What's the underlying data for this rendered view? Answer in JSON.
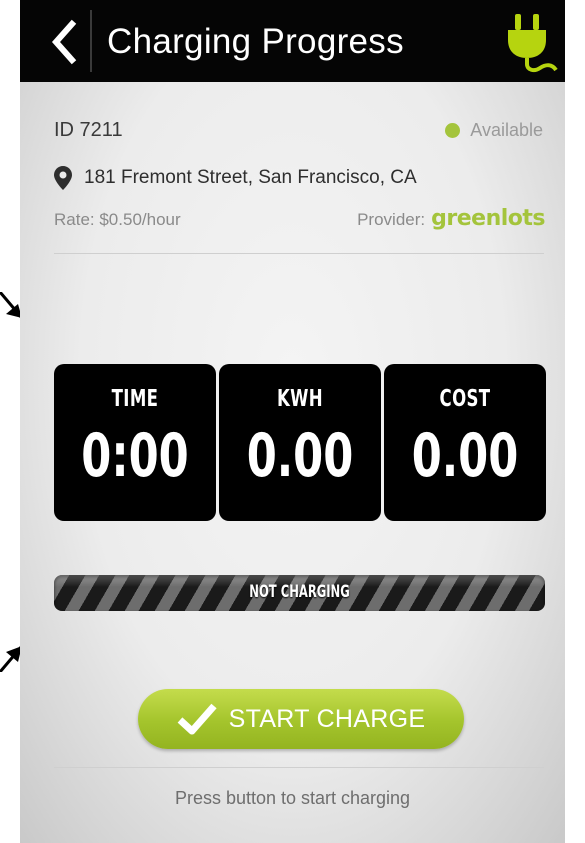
{
  "header": {
    "title": "Charging Progress"
  },
  "station": {
    "id_text": "ID 7211",
    "status_text": "Available",
    "address": "181 Fremont Street, San Francisco, CA",
    "rate": "Rate: $0.50/hour",
    "provider_label": "Provider:",
    "provider_name": "greenlots"
  },
  "meters": {
    "time_label": "TIME",
    "time_value": "0:00",
    "kwh_label": "KWH",
    "kwh_value": "0.00",
    "cost_label": "COST",
    "cost_value": "0.00"
  },
  "progress": {
    "label": "NOT CHARGING",
    "fraction": 0
  },
  "actions": {
    "start_label": "START CHARGE"
  },
  "footer": {
    "hint": "Press button to start charging"
  },
  "colors": {
    "accent": "#a4c43c",
    "header_bg": "#050505",
    "meter_bg": "#000000"
  },
  "icons": {
    "back": "chevron-left-icon",
    "plug": "plug-icon",
    "pin": "map-pin-icon",
    "check": "checkmark-icon",
    "status_dot": "status-dot-icon"
  }
}
